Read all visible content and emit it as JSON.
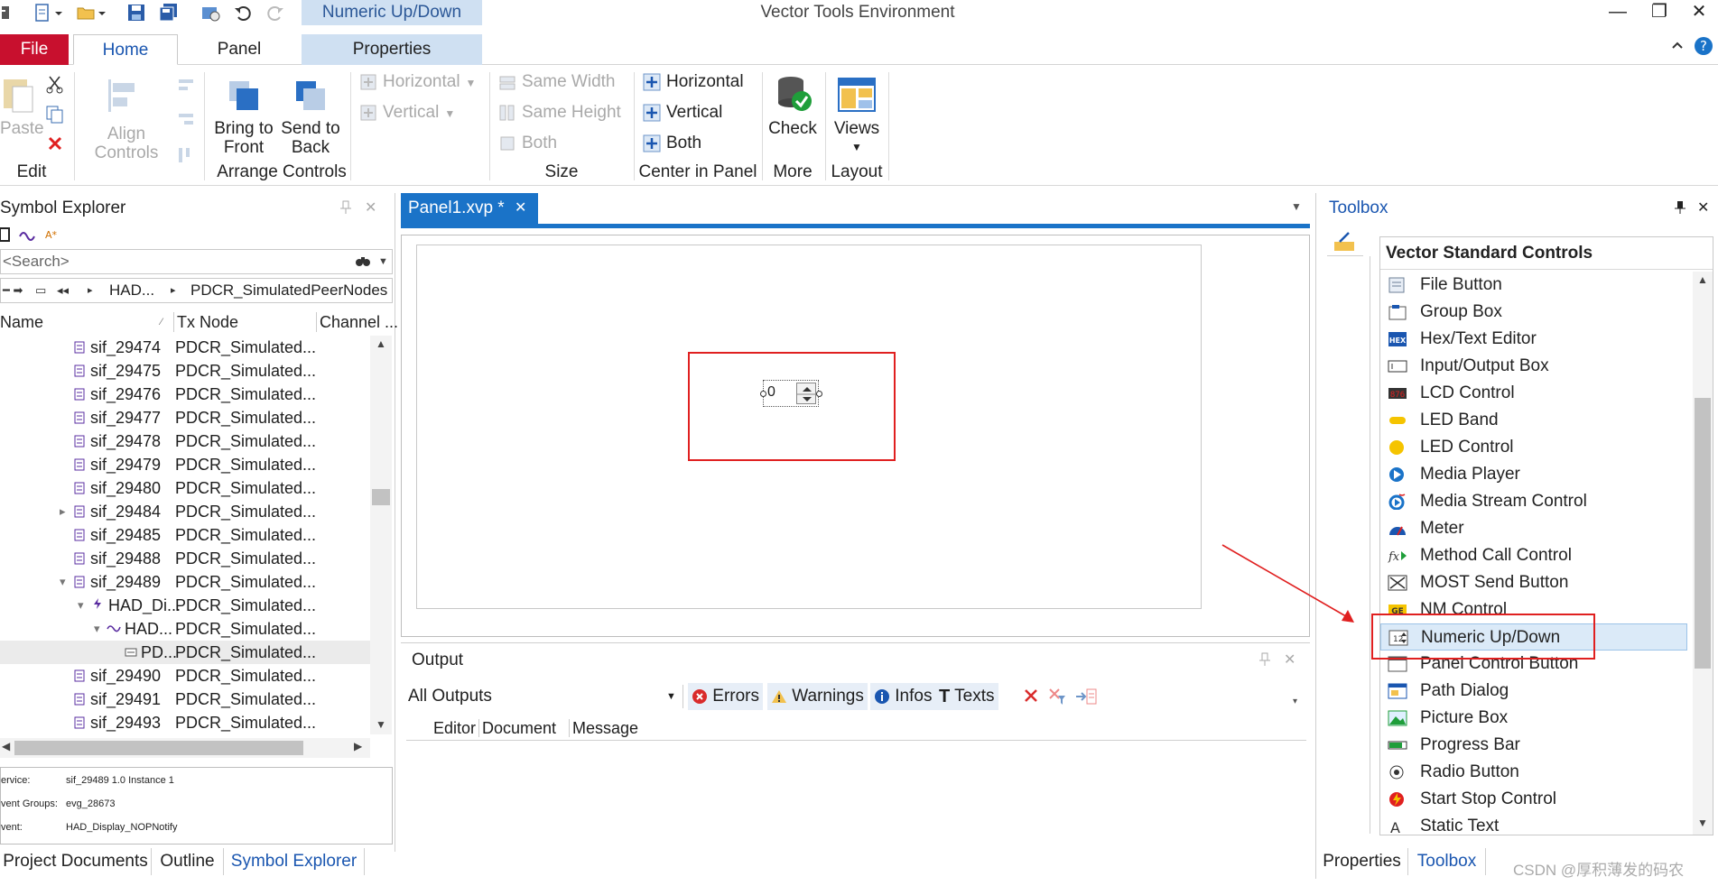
{
  "titlebar": {
    "context_tab": "Numeric Up/Down",
    "window_title": "Vector Tools Environment",
    "minimize": "—",
    "restore": "❐",
    "close": "✕"
  },
  "ribbon": {
    "tabs": {
      "file": "File",
      "home": "Home",
      "panel": "Panel",
      "properties": "Properties"
    },
    "edit": {
      "paste": "Paste",
      "group": "Edit"
    },
    "arrange": {
      "align_controls": "Align Controls",
      "bring_to_front_l1": "Bring to",
      "bring_to_front_l2": "Front",
      "send_to_back_l1": "Send to",
      "send_to_back_l2": "Back",
      "horizontal": "Horizontal",
      "vertical": "Vertical",
      "group": "Arrange Controls"
    },
    "size": {
      "same_width": "Same Width",
      "same_height": "Same Height",
      "both": "Both",
      "group": "Size"
    },
    "center": {
      "horizontal": "Horizontal",
      "vertical": "Vertical",
      "both": "Both",
      "group": "Center in Panel"
    },
    "more": {
      "check": "Check",
      "group": "More"
    },
    "layout": {
      "views": "Views",
      "group": "Layout"
    }
  },
  "symbol_explorer": {
    "title": "Symbol Explorer",
    "search_placeholder": "<Search>",
    "breadcrumb_1": "HAD...",
    "breadcrumb_2": "PDCR_SimulatedPeerNodes",
    "columns": {
      "name": "Name",
      "tx_node": "Tx Node",
      "channel": "Channel ..."
    },
    "rows": [
      {
        "name": "sif_29474",
        "node": "PDCR_Simulated..."
      },
      {
        "name": "sif_29475",
        "node": "PDCR_Simulated..."
      },
      {
        "name": "sif_29476",
        "node": "PDCR_Simulated..."
      },
      {
        "name": "sif_29477",
        "node": "PDCR_Simulated..."
      },
      {
        "name": "sif_29478",
        "node": "PDCR_Simulated..."
      },
      {
        "name": "sif_29479",
        "node": "PDCR_Simulated..."
      },
      {
        "name": "sif_29480",
        "node": "PDCR_Simulated..."
      },
      {
        "name": "sif_29484",
        "node": "PDCR_Simulated..."
      },
      {
        "name": "sif_29485",
        "node": "PDCR_Simulated..."
      },
      {
        "name": "sif_29488",
        "node": "PDCR_Simulated..."
      },
      {
        "name": "sif_29489",
        "node": "PDCR_Simulated..."
      },
      {
        "name": "HAD_Di...",
        "node": "PDCR_Simulated..."
      },
      {
        "name": "HAD...",
        "node": "PDCR_Simulated..."
      },
      {
        "name": "PD...",
        "node": "PDCR_Simulated..."
      },
      {
        "name": "sif_29490",
        "node": "PDCR_Simulated..."
      },
      {
        "name": "sif_29491",
        "node": "PDCR_Simulated..."
      },
      {
        "name": "sif_29493",
        "node": "PDCR_Simulated..."
      }
    ],
    "info": {
      "service_label": "ervice:",
      "service_value": "sif_29489 1.0 Instance 1",
      "groups_label": "vent Groups:",
      "groups_value": "evg_28673",
      "event_label": "vent:",
      "event_value": "HAD_Display_NOPNotify"
    },
    "bottom_tabs": {
      "project_documents": "Project Documents",
      "outline": "Outline",
      "symbol_explorer": "Symbol Explorer"
    }
  },
  "document": {
    "tab_label": "Panel1.xvp *",
    "numeric_value": "0"
  },
  "output": {
    "title": "Output",
    "filter": "All Outputs",
    "errors": "Errors",
    "warnings": "Warnings",
    "infos": "Infos",
    "texts": "Texts",
    "columns": {
      "editor": "Editor",
      "document": "Document",
      "message": "Message"
    }
  },
  "toolbox": {
    "title": "Toolbox",
    "category": "Vector Standard Controls",
    "items": [
      "File Button",
      "Group Box",
      "Hex/Text Editor",
      "Input/Output Box",
      "LCD Control",
      "LED Band",
      "LED Control",
      "Media Player",
      "Media Stream Control",
      "Meter",
      "Method Call Control",
      "MOST Send Button",
      "NM Control",
      "Numeric Up/Down",
      "Panel Control Button",
      "Path Dialog",
      "Picture Box",
      "Progress Bar",
      "Radio Button",
      "Start Stop Control",
      "Static Text"
    ],
    "selected_index": 13,
    "bottom_tabs": {
      "properties": "Properties",
      "toolbox": "Toolbox"
    }
  },
  "watermark": "CSDN @厚积薄发的码农",
  "colors": {
    "accent": "#1a73c8",
    "file_tab": "#c8102e",
    "annotation": "#e02020"
  }
}
